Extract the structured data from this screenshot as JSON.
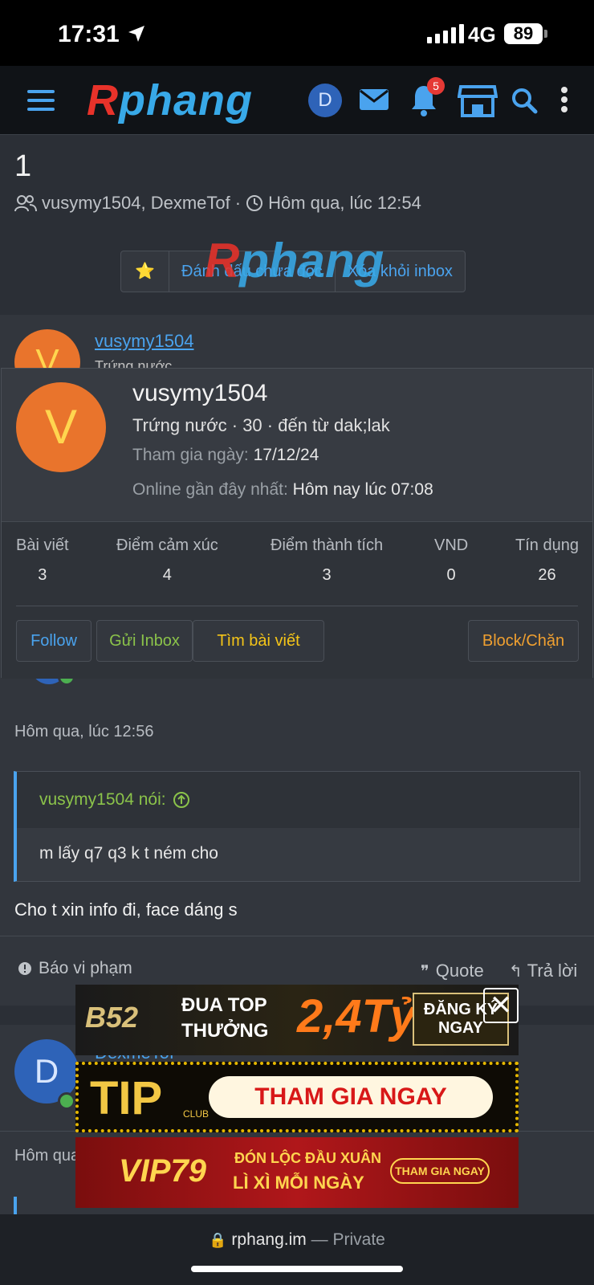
{
  "status_bar": {
    "time": "17:31",
    "network": "4G",
    "battery": "89"
  },
  "header": {
    "logo_first": "R",
    "logo_rest": "phang",
    "avatar_letter": "D",
    "notification_count": "5"
  },
  "thread": {
    "title": "1",
    "participants": "vusymy1504, DexmeTof",
    "separator": "·",
    "time": "Hôm qua, lúc 12:54",
    "actions": {
      "star": "⭐",
      "mark_unread": "Đánh dấu chưa đọc",
      "remove_inbox": "Xóa khỏi inbox"
    }
  },
  "message1": {
    "avatar_letter": "V",
    "username": "vusymy1504",
    "user_title_partial": "Trứng nước",
    "date": "Hôm qua, lúc 12:56",
    "quote_author": "vusymy1504 nói:",
    "quote_text": "m lấy q7 q3 k t ném cho",
    "text": "Cho t xin info đi, face dáng s",
    "report": "Báo vi phạm",
    "quote": "Quote",
    "reply": "Trả lời"
  },
  "popup": {
    "avatar_letter": "V",
    "name": "vusymy1504",
    "info": "Trứng nước · 30 · đến từ dak;lak",
    "joined_label": "Tham gia ngày:",
    "joined_value": "17/12/24",
    "online_label": "Online gần đây nhất:",
    "online_value": "Hôm nay lúc 07:08",
    "stats": [
      {
        "label": "Bài viết",
        "value": "3"
      },
      {
        "label": "Điểm cảm xúc",
        "value": "4"
      },
      {
        "label": "Điểm thành tích",
        "value": "3"
      },
      {
        "label": "VND",
        "value": "0"
      },
      {
        "label": "Tín dụng",
        "value": "26"
      }
    ],
    "buttons": {
      "follow": "Follow",
      "inbox": "Gửi Inbox",
      "find_posts": "Tìm bài viết",
      "block": "Block/Chặn"
    }
  },
  "message2": {
    "avatar_letter": "D",
    "username": "DexmeTof",
    "date_partial": "Hôm qua"
  },
  "ads": [
    {
      "brand": "B52",
      "line1": "ĐUA TOP",
      "line2": "THƯỞNG",
      "amount": "2,4Tỷ",
      "cta": "ĐĂNG KÝ NGAY"
    },
    {
      "brand": "TIP",
      "sub": "CLUB",
      "cta": "THAM GIA NGAY"
    },
    {
      "brand": "VIP79",
      "line1": "ĐÓN LỘC ĐẦU XUÂN",
      "line2": "LÌ XÌ MỖI NGÀY",
      "cta": "THAM GIA NGAY"
    }
  ],
  "ad_close": "✕",
  "browser": {
    "url": "rphang.im",
    "dash": "—",
    "mode": "Private"
  },
  "colors": {
    "accent": "#4aa3ee",
    "logo_red": "#e8322a",
    "green": "#8bc34a",
    "orange": "#f0a030"
  }
}
